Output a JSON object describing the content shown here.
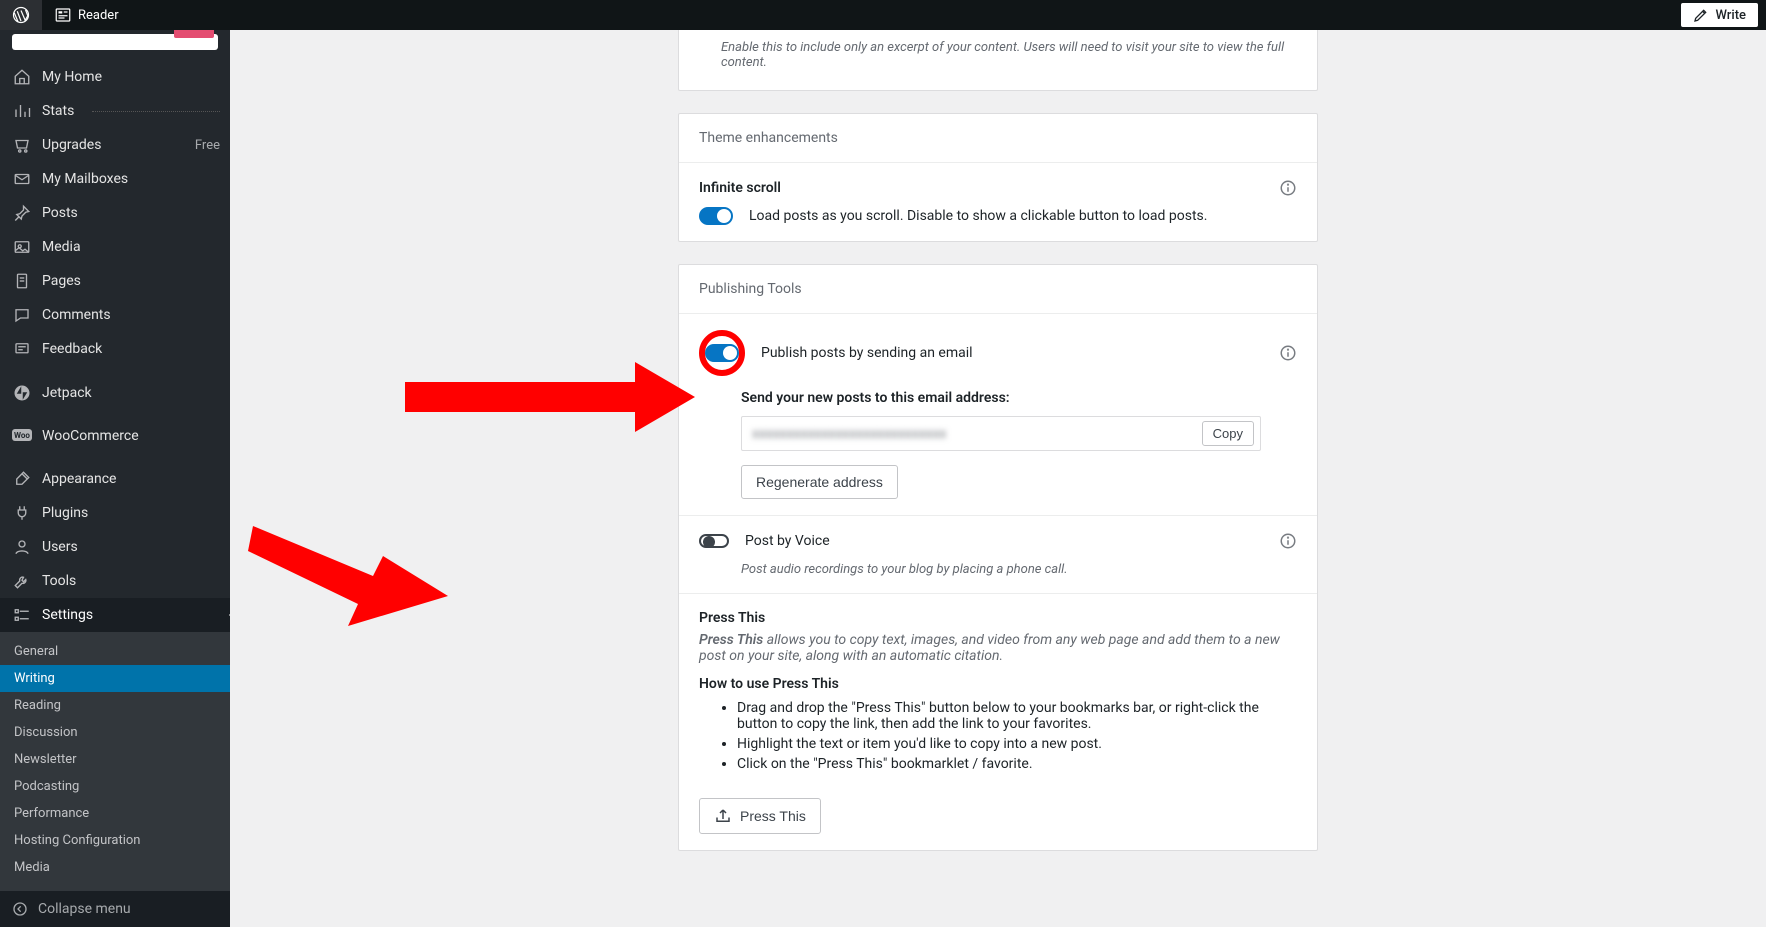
{
  "toolbar": {
    "reader_label": "Reader",
    "write_label": "Write"
  },
  "sidebar": {
    "items": [
      {
        "label": "My Home",
        "icon": "home"
      },
      {
        "label": "Stats",
        "icon": "stats",
        "has_divider": true
      },
      {
        "label": "Upgrades",
        "icon": "cart",
        "badge": "Free"
      },
      {
        "label": "My Mailboxes",
        "icon": "mail"
      },
      {
        "label": "Posts",
        "icon": "pin"
      },
      {
        "label": "Media",
        "icon": "media"
      },
      {
        "label": "Pages",
        "icon": "pages"
      },
      {
        "label": "Comments",
        "icon": "comments"
      },
      {
        "label": "Feedback",
        "icon": "feedback"
      },
      {
        "label": "Jetpack",
        "icon": "jetpack",
        "gap_before": true
      },
      {
        "label": "WooCommerce",
        "icon": "woo",
        "gap_before": true
      },
      {
        "label": "Appearance",
        "icon": "brush",
        "gap_before": true
      },
      {
        "label": "Plugins",
        "icon": "plug"
      },
      {
        "label": "Users",
        "icon": "user"
      },
      {
        "label": "Tools",
        "icon": "tools"
      },
      {
        "label": "Settings",
        "icon": "settings",
        "is_settings": true
      }
    ],
    "submenu": [
      "General",
      "Writing",
      "Reading",
      "Discussion",
      "Newsletter",
      "Podcasting",
      "Performance",
      "Hosting Configuration",
      "Media"
    ],
    "submenu_active_index": 1,
    "collapse_label": "Collapse menu"
  },
  "settings_page": {
    "excerpt_help": "Enable this to include only an excerpt of your content. Users will need to visit your site to view the full content.",
    "theme_panel": {
      "title": "Theme enhancements",
      "infinite_title": "Infinite scroll",
      "infinite_desc": "Load posts as you scroll. Disable to show a clickable button to load posts."
    },
    "pub_panel": {
      "title": "Publishing Tools",
      "email_toggle_label": "Publish posts by sending an email",
      "email_field_label": "Send your new posts to this email address:",
      "email_value": "xxxxxxxxxxxxxxxxxxxxxxxxxxxx",
      "copy_label": "Copy",
      "regen_label": "Regenerate address",
      "voice_label": "Post by Voice",
      "voice_help": "Post audio recordings to your blog by placing a phone call.",
      "press_title": "Press This",
      "press_desc_lead": "Press This",
      "press_desc_rest": " allows you to copy text, images, and video from any web page and add them to a new post on your site, along with an automatic citation.",
      "press_howto": "How to use Press This",
      "press_steps": [
        "Drag and drop the \"Press This\" button below to your bookmarks bar, or right-click the button to copy the link, then add the link to your favorites.",
        "Highlight the text or item you'd like to copy into a new post.",
        "Click on the \"Press This\" bookmarklet / favorite."
      ],
      "press_button": "Press This"
    }
  }
}
